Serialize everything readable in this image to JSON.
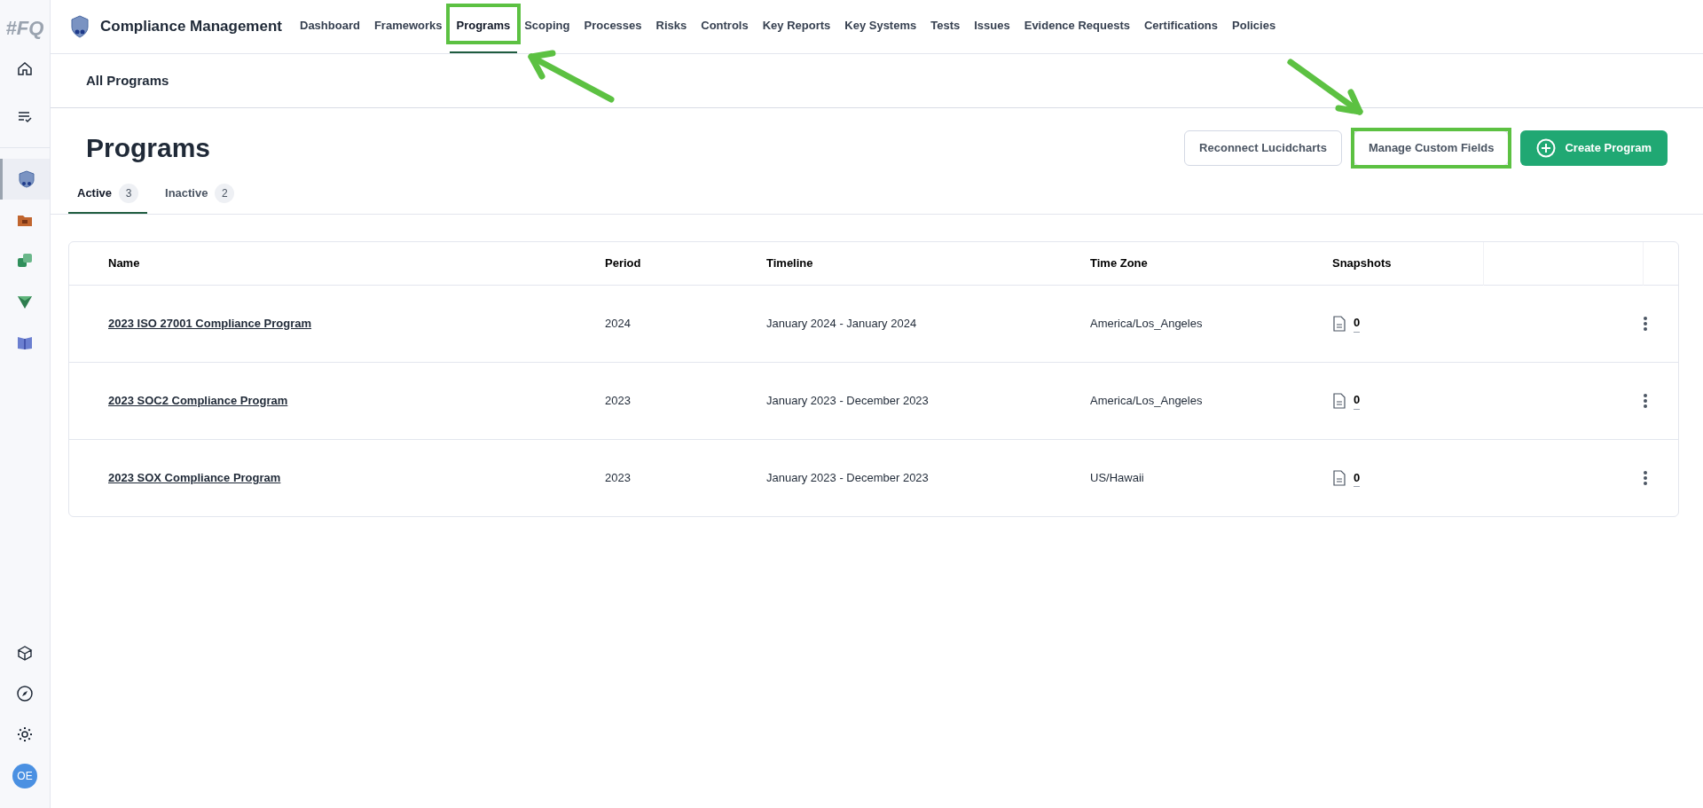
{
  "sidebar": {
    "logo": "#FQ",
    "items": [
      {
        "selected": false
      },
      {
        "selected": false
      },
      {
        "selected": true
      },
      {
        "selected": false
      },
      {
        "selected": false
      },
      {
        "selected": false
      },
      {
        "selected": false
      }
    ],
    "avatar": "OE"
  },
  "app_title": "Compliance Management",
  "nav": [
    {
      "label": "Dashboard",
      "selected": false
    },
    {
      "label": "Frameworks",
      "selected": false
    },
    {
      "label": "Programs",
      "selected": true
    },
    {
      "label": "Scoping",
      "selected": false
    },
    {
      "label": "Processes",
      "selected": false
    },
    {
      "label": "Risks",
      "selected": false
    },
    {
      "label": "Controls",
      "selected": false
    },
    {
      "label": "Key Reports",
      "selected": false
    },
    {
      "label": "Key Systems",
      "selected": false
    },
    {
      "label": "Tests",
      "selected": false
    },
    {
      "label": "Issues",
      "selected": false
    },
    {
      "label": "Evidence Requests",
      "selected": false
    },
    {
      "label": "Certifications",
      "selected": false
    },
    {
      "label": "Policies",
      "selected": false
    }
  ],
  "breadcrumb": "All Programs",
  "page_title": "Programs",
  "actions": [
    {
      "label": "Reconnect Lucidcharts",
      "kind": "outline"
    },
    {
      "label": "Manage Custom Fields",
      "kind": "outline"
    },
    {
      "label": "Create Program",
      "kind": "primary"
    }
  ],
  "tabs": [
    {
      "label": "Active",
      "count": "3",
      "selected": true
    },
    {
      "label": "Inactive",
      "count": "2",
      "selected": false
    }
  ],
  "table": {
    "columns": [
      "Name",
      "Period",
      "Timeline",
      "Time Zone",
      "Snapshots"
    ],
    "rows": [
      {
        "name": "2023 ISO 27001 Compliance Program",
        "period": "2024",
        "timeline": "January 2024 - January 2024",
        "time_zone": "America/Los_Angeles",
        "snapshots": "0"
      },
      {
        "name": "2023 SOC2 Compliance Program",
        "period": "2023",
        "timeline": "January 2023 - December 2023",
        "time_zone": "America/Los_Angeles",
        "snapshots": "0"
      },
      {
        "name": "2023 SOX Compliance Program",
        "period": "2023",
        "timeline": "January 2023 - December 2023",
        "time_zone": "US/Hawaii",
        "snapshots": "0"
      }
    ]
  }
}
